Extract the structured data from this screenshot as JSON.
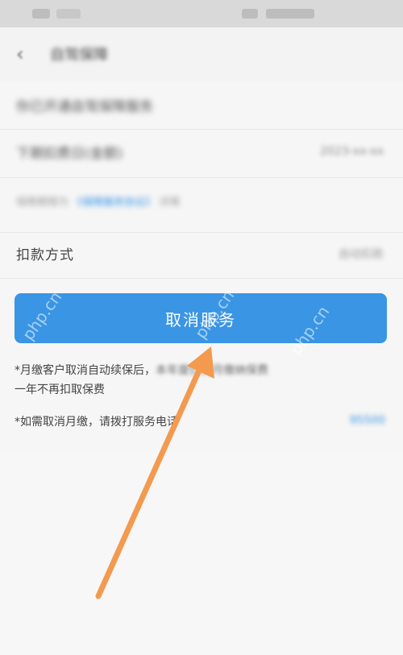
{
  "status_bar": {},
  "nav": {
    "title": "自驾保障"
  },
  "rows": {
    "service_enabled": "你已开通自驾保障服务",
    "next_deduction_label": "下期扣费日(金额)",
    "next_deduction_value": "2023-xx-xx",
    "notice_prefix": "保障期限为 ",
    "notice_link": "《保障服务协议》",
    "notice_suffix": " 详情",
    "payment_label": "扣款方式",
    "payment_value": "自动扣款"
  },
  "cancel_button": {
    "label": "取消服务"
  },
  "notes": {
    "note1_line1_clear": "*月缴客户取消自动续保后，",
    "note1_line1_blurred": "本年度仍按月缴纳保费",
    "note1_line2": "一年不再扣取保费",
    "note2": "*如需取消月缴，请拨打服务电话",
    "phone_link": "95500"
  },
  "watermarks": [
    "php.cn",
    "php.cn",
    "php.cn"
  ],
  "colors": {
    "accent": "#3a95e4",
    "arrow": "#f39a4f"
  }
}
